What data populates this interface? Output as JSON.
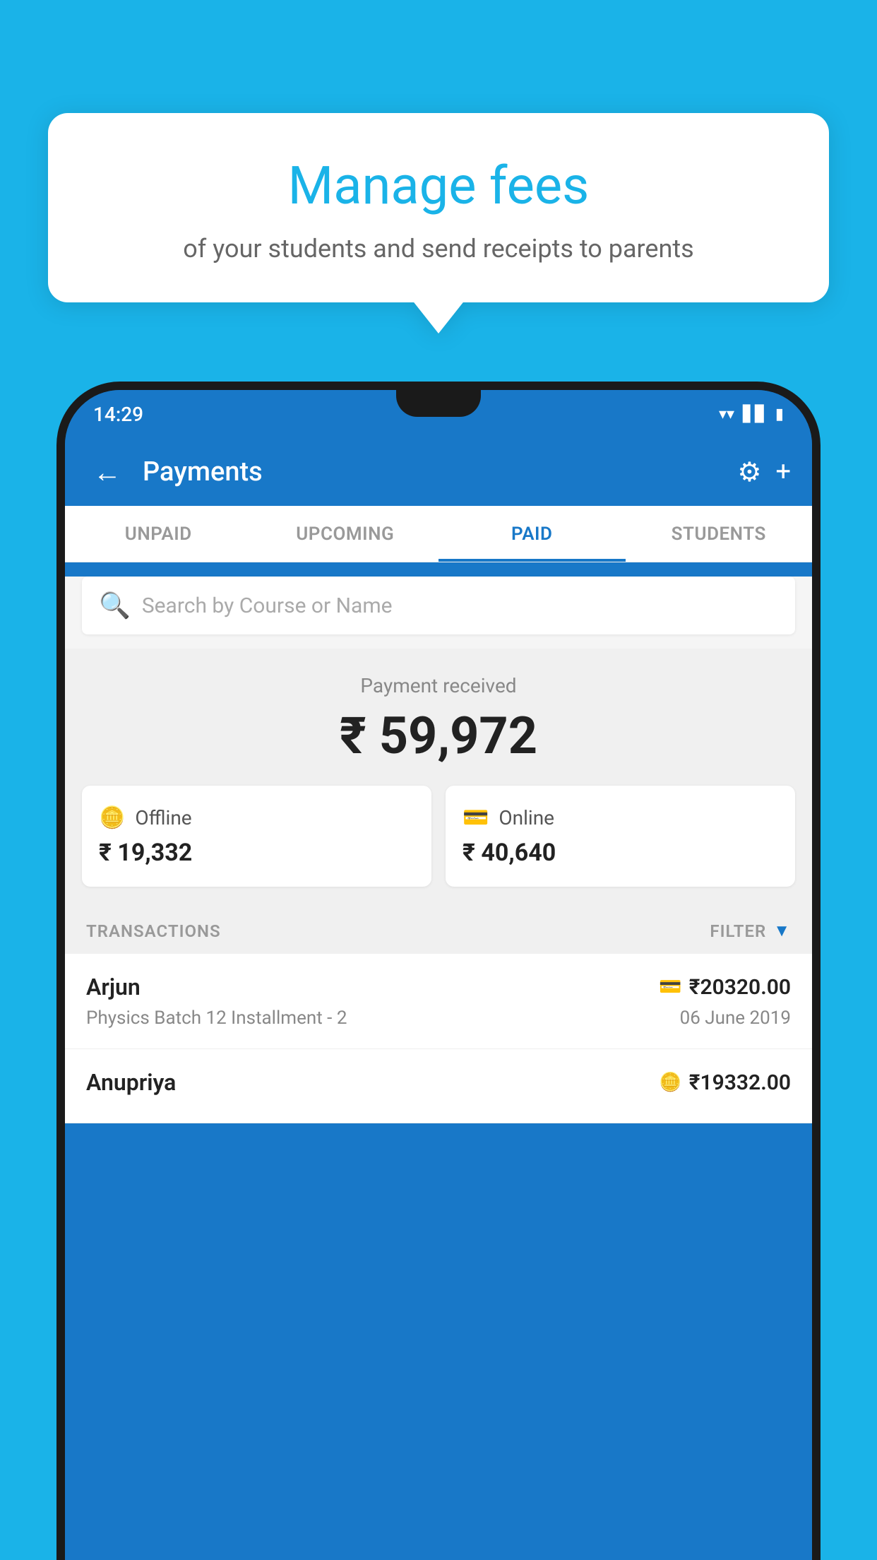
{
  "background_color": "#1ab3e8",
  "bubble": {
    "title": "Manage fees",
    "subtitle": "of your students and send receipts to parents"
  },
  "phone": {
    "status_bar": {
      "time": "14:29",
      "icons": [
        "wifi",
        "signal",
        "battery"
      ]
    },
    "app_bar": {
      "back_label": "←",
      "title": "Payments",
      "settings_icon": "⚙",
      "add_icon": "+"
    },
    "tabs": [
      {
        "label": "UNPAID",
        "active": false
      },
      {
        "label": "UPCOMING",
        "active": false
      },
      {
        "label": "PAID",
        "active": true
      },
      {
        "label": "STUDENTS",
        "active": false
      }
    ],
    "search": {
      "placeholder": "Search by Course or Name"
    },
    "payment_summary": {
      "label": "Payment received",
      "amount": "₹ 59,972"
    },
    "payment_cards": [
      {
        "icon": "💳",
        "label": "Offline",
        "amount": "₹ 19,332"
      },
      {
        "icon": "💳",
        "label": "Online",
        "amount": "₹ 40,640"
      }
    ],
    "transactions_section": {
      "label": "TRANSACTIONS",
      "filter_label": "FILTER"
    },
    "transactions": [
      {
        "name": "Arjun",
        "course": "Physics Batch 12 Installment - 2",
        "amount": "₹20320.00",
        "date": "06 June 2019",
        "payment_type": "online"
      },
      {
        "name": "Anupriya",
        "course": "",
        "amount": "₹19332.00",
        "date": "",
        "payment_type": "offline"
      }
    ]
  }
}
